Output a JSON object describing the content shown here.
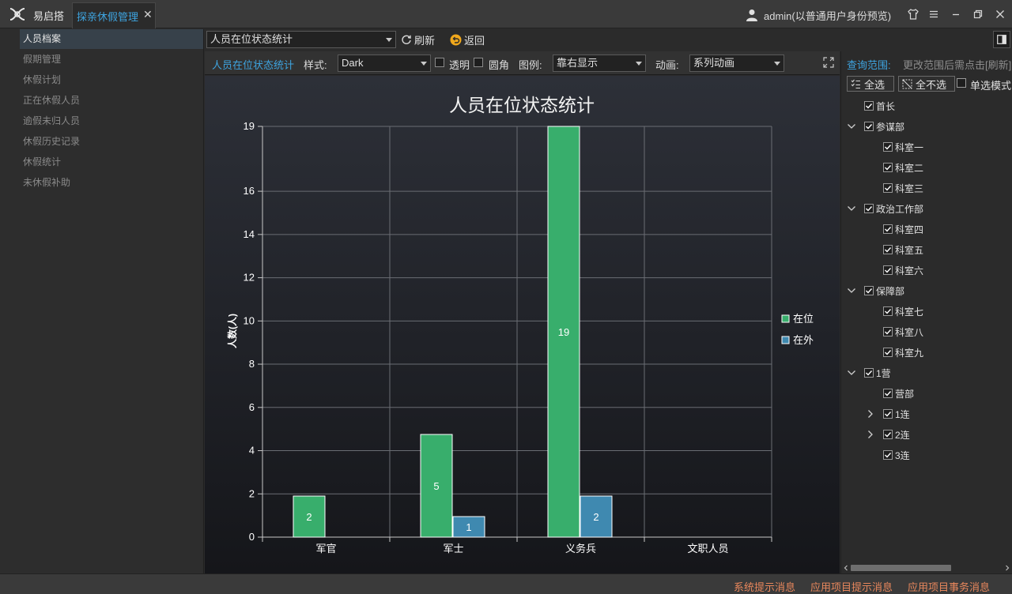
{
  "titlebar": {
    "app_name": "易启搭",
    "active_tab": "探亲休假管理",
    "user": "admin(以普通用户身份预览)"
  },
  "nav": [
    "人员档案",
    "假期管理",
    "休假计划",
    "正在休假人员",
    "逾假未归人员",
    "休假历史记录",
    "休假统计",
    "未休假补助"
  ],
  "toolbar": {
    "report_select": "人员在位状态统计",
    "refresh_label": "刷新",
    "back_label": "返回"
  },
  "panel": {
    "title": "人员在位状态统计",
    "style_label": "样式:",
    "style_value": "Dark",
    "transparent_label": "透明",
    "rounded_label": "圆角",
    "legend_label": "图例:",
    "legend_value": "靠右显示",
    "animation_label": "动画:",
    "animation_value": "系列动画"
  },
  "chart_data": {
    "type": "bar",
    "title": "人员在位状态统计",
    "xlabel": "",
    "ylabel": "人数(人)",
    "categories": [
      "军官",
      "军士",
      "义务兵",
      "文职人员"
    ],
    "series": [
      {
        "name": "在位",
        "values": [
          2,
          5,
          19,
          0
        ],
        "labels": [
          "2",
          "5",
          "19",
          ""
        ]
      },
      {
        "name": "在外",
        "values": [
          0,
          1,
          2,
          0
        ],
        "labels": [
          "",
          "1",
          "2",
          ""
        ]
      }
    ],
    "plotted_values": [
      [
        1.9,
        4.75,
        19,
        0
      ],
      [
        0,
        0.95,
        1.9,
        0
      ]
    ],
    "ylim": [
      0,
      19
    ],
    "yticks": [
      "0",
      "2",
      "4",
      "6",
      "8",
      "10",
      "12",
      "14",
      "16",
      "19"
    ],
    "grid": true,
    "legend_position": "right",
    "colors": [
      "#38ae6c",
      "#3f89b0"
    ]
  },
  "right_panel": {
    "title": "查询范围:",
    "hint": "更改范围后需点击[刷新]",
    "select_all": "全选",
    "select_none": "全不选",
    "single_mode": "单选模式",
    "tree": [
      {
        "label": "首长",
        "level": 0,
        "expander": "none"
      },
      {
        "label": "参谋部",
        "level": 0,
        "expander": "expanded"
      },
      {
        "label": "科室一",
        "level": 1,
        "expander": "none"
      },
      {
        "label": "科室二",
        "level": 1,
        "expander": "none"
      },
      {
        "label": "科室三",
        "level": 1,
        "expander": "none"
      },
      {
        "label": "政治工作部",
        "level": 0,
        "expander": "expanded"
      },
      {
        "label": "科室四",
        "level": 1,
        "expander": "none"
      },
      {
        "label": "科室五",
        "level": 1,
        "expander": "none"
      },
      {
        "label": "科室六",
        "level": 1,
        "expander": "none"
      },
      {
        "label": "保障部",
        "level": 0,
        "expander": "expanded"
      },
      {
        "label": "科室七",
        "level": 1,
        "expander": "none"
      },
      {
        "label": "科室八",
        "level": 1,
        "expander": "none"
      },
      {
        "label": "科室九",
        "level": 1,
        "expander": "none"
      },
      {
        "label": "1营",
        "level": 0,
        "expander": "expanded"
      },
      {
        "label": "营部",
        "level": 1,
        "expander": "none"
      },
      {
        "label": "1连",
        "level": 1,
        "expander": "collapsed"
      },
      {
        "label": "2连",
        "level": 1,
        "expander": "collapsed"
      },
      {
        "label": "3连",
        "level": 1,
        "expander": "none"
      }
    ]
  },
  "status": {
    "sys_msg": "系统提示消息",
    "app_msg": "应用项目提示消息",
    "app_task": "应用项目事务消息"
  }
}
